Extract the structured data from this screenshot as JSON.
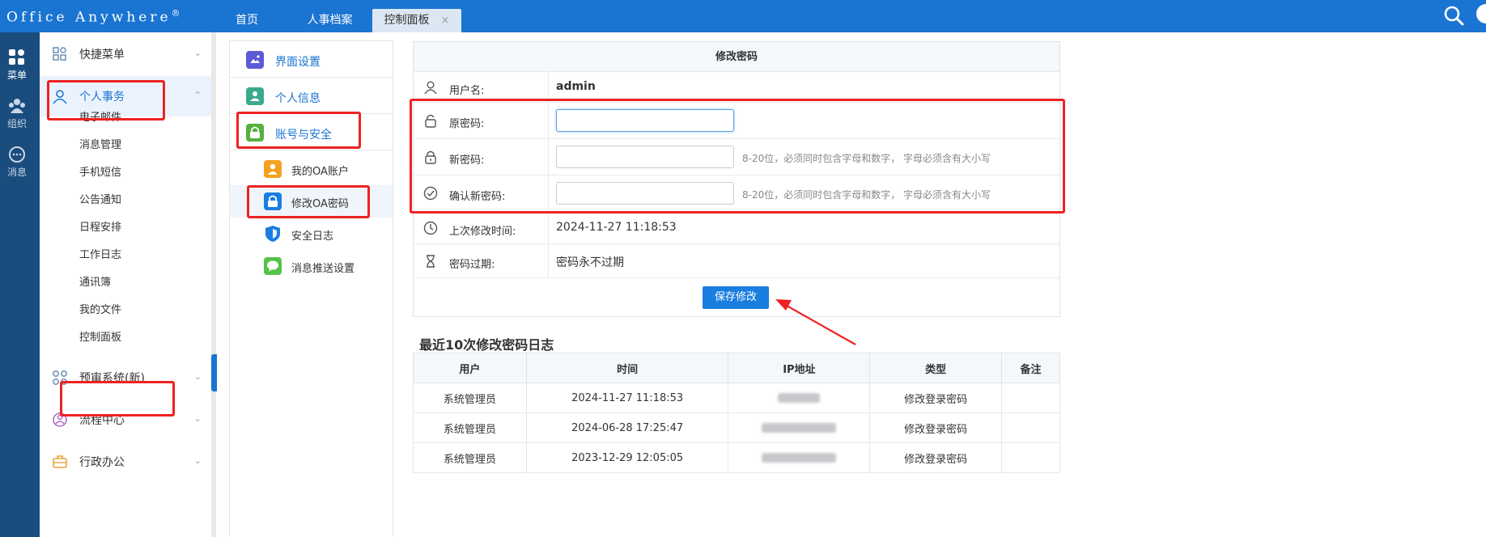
{
  "app": {
    "logo": "Office Anywhere",
    "logo_mark": "®"
  },
  "top_tabs": [
    {
      "label": "首页"
    },
    {
      "label": "人事档案"
    },
    {
      "label": "控制面板",
      "close": "×"
    }
  ],
  "rail": [
    {
      "label": "菜单",
      "icon": "grid-icon"
    },
    {
      "label": "组织",
      "icon": "org-icon"
    },
    {
      "label": "消息",
      "icon": "message-icon"
    }
  ],
  "menu": {
    "groups": [
      {
        "label": "快捷菜单",
        "icon": "shortcut-icon"
      },
      {
        "label": "个人事务",
        "icon": "person-icon"
      },
      {
        "label": "预审系统(新)",
        "icon": "apps-icon"
      },
      {
        "label": "流程中心",
        "icon": "flow-icon"
      },
      {
        "label": "行政办公",
        "icon": "briefcase-icon"
      }
    ],
    "sub_items": [
      "电子邮件",
      "消息管理",
      "手机短信",
      "公告通知",
      "日程安排",
      "工作日志",
      "通讯簿",
      "我的文件",
      "控制面板"
    ]
  },
  "settings_nav": {
    "sections": [
      {
        "label": "界面设置",
        "color": "#5b5bd6"
      },
      {
        "label": "个人信息",
        "color": "#3aaa8c"
      },
      {
        "label": "账号与安全",
        "color": "#56b03e"
      }
    ],
    "sub_items": [
      {
        "label": "我的OA账户",
        "color": "#f5a020"
      },
      {
        "label": "修改OA密码",
        "color": "#1a7ee0"
      },
      {
        "label": "安全日志",
        "color": "#1a7ee0"
      },
      {
        "label": "消息推送设置",
        "color": "#56c24a"
      }
    ]
  },
  "form": {
    "title": "修改密码",
    "username_label": "用户名:",
    "username_value": "admin",
    "old_pw_label": "原密码:",
    "new_pw_label": "新密码:",
    "confirm_pw_label": "确认新密码:",
    "pw_hint": "8-20位，必须同时包含字母和数字， 字母必须含有大小写",
    "last_change_label": "上次修改时间:",
    "last_change_value": "2024-11-27 11:18:53",
    "expire_label": "密码过期:",
    "expire_value": "密码永不过期",
    "save_button": "保存修改"
  },
  "log": {
    "title": "最近10次修改密码日志",
    "headers": [
      "用户",
      "时间",
      "IP地址",
      "类型",
      "备注"
    ],
    "rows": [
      {
        "user": "系统管理员",
        "time": "2024-11-27 11:18:53",
        "type": "修改登录密码",
        "note": ""
      },
      {
        "user": "系统管理员",
        "time": "2024-06-28 17:25:47",
        "type": "修改登录密码",
        "note": ""
      },
      {
        "user": "系统管理员",
        "time": "2023-12-29 12:05:05",
        "type": "修改登录密码",
        "note": ""
      }
    ]
  },
  "colors": {
    "topbar": "#1a74d2",
    "rail": "#1a4c7e",
    "annotation_red": "#ee2222"
  }
}
